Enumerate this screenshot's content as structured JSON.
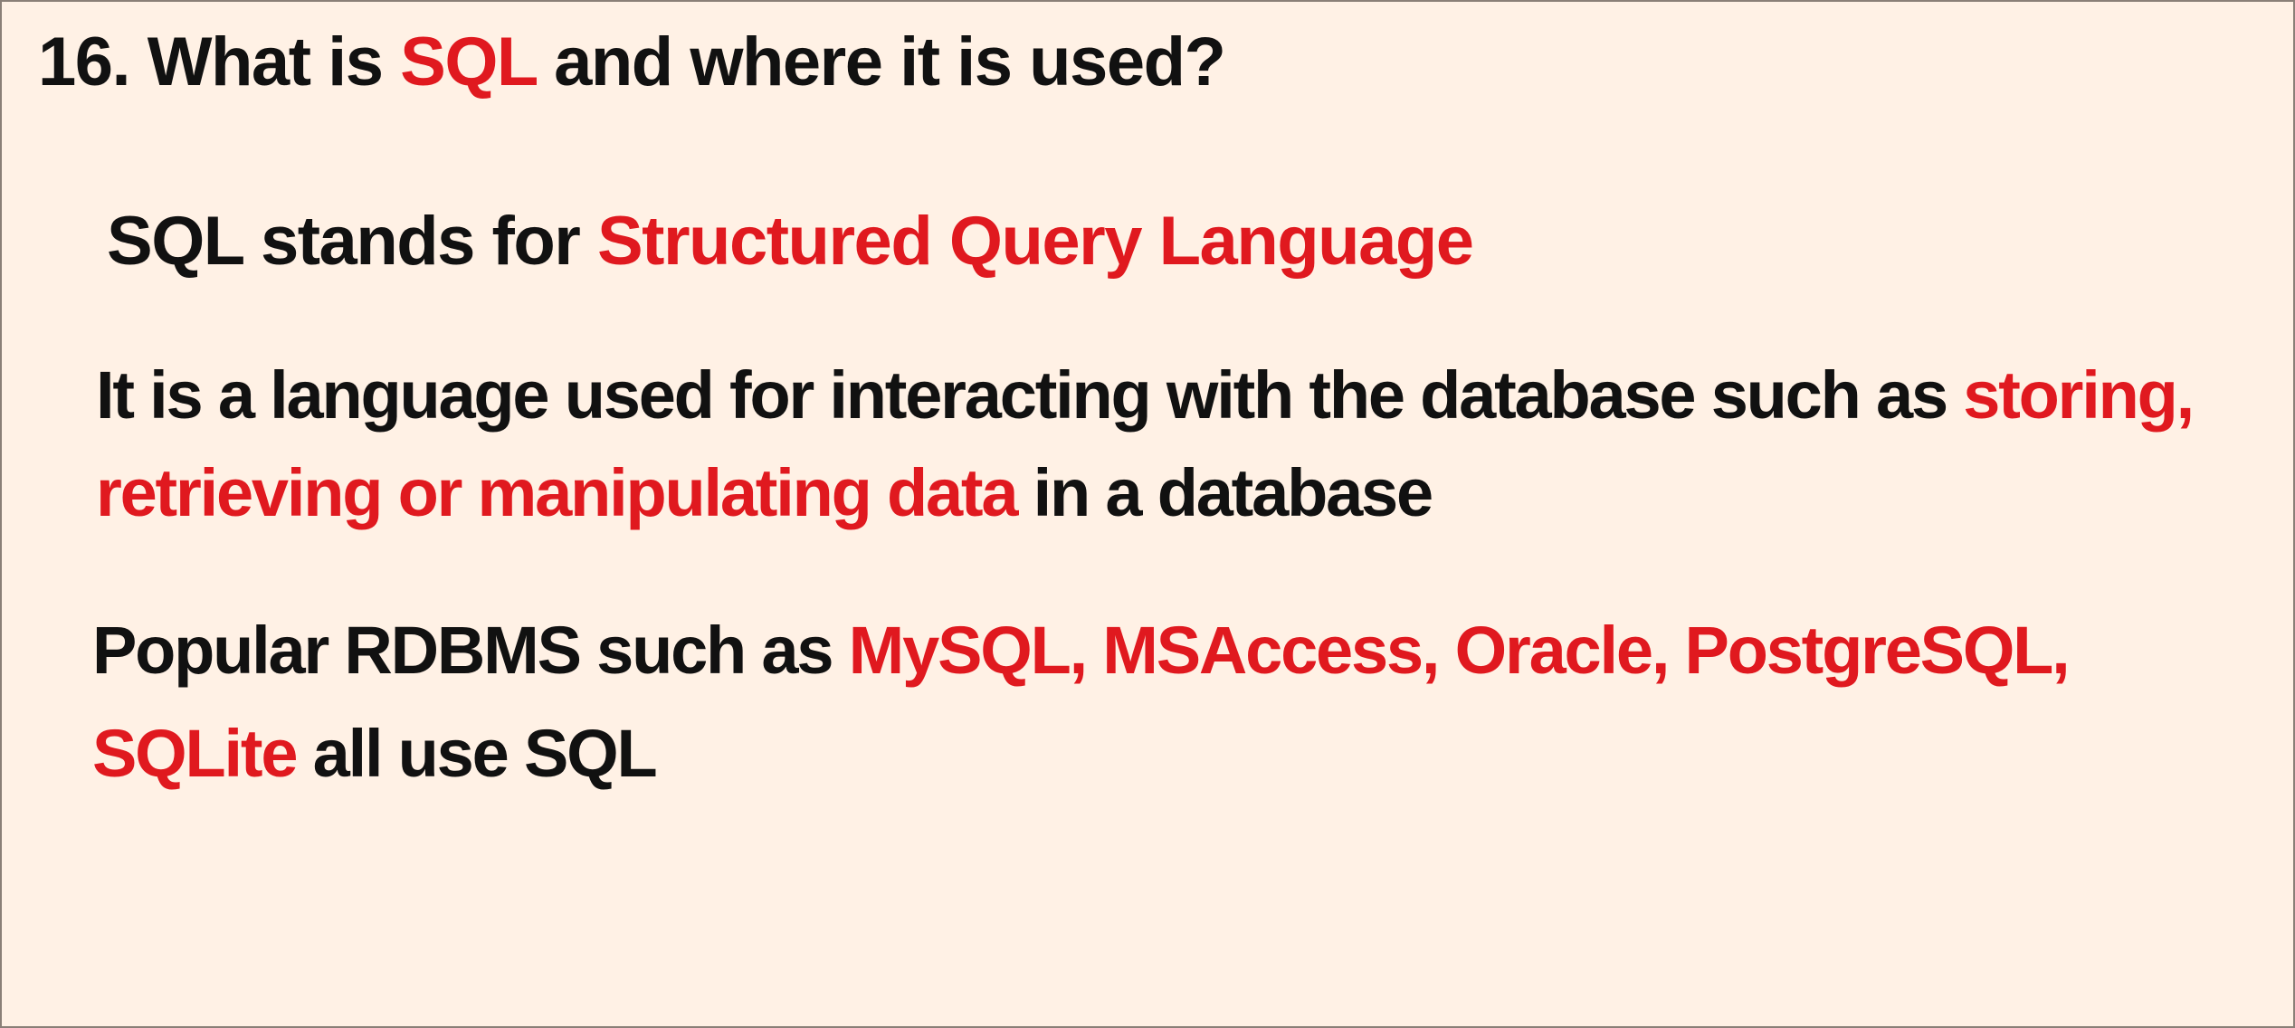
{
  "colors": {
    "background": "#fff1e5",
    "text": "#111111",
    "highlight": "#e0191f",
    "border": "#8a7f77"
  },
  "title": {
    "before": "16. What is ",
    "highlight": "SQL",
    "after": " and where it is used?"
  },
  "point1": {
    "before": "SQL stands for ",
    "highlight": "Structured Query Language"
  },
  "point2": {
    "line1_text": "It is a language used for interacting with the database such as ",
    "line1_highlight": "storing,",
    "line2_highlight": "retrieving or manipulating data",
    "line2_text": " in a database"
  },
  "point3": {
    "line1_text": "Popular RDBMS such as ",
    "line1_highlight": "MySQL, MSAccess, Oracle, PostgreSQL,",
    "line2_highlight": "SQLite",
    "line2_text": " all use SQL"
  }
}
